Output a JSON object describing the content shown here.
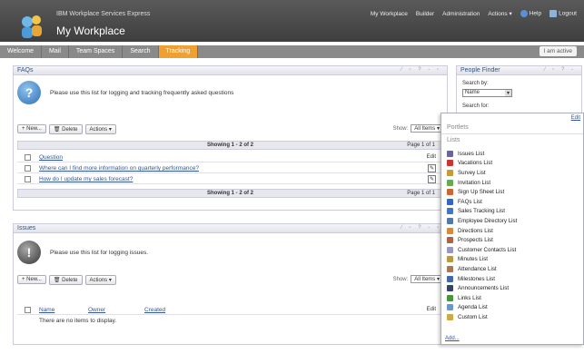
{
  "header": {
    "product": "IBM Workplace Services Express",
    "title": "My Workplace",
    "links": [
      "My Workplace",
      "Builder",
      "Administration",
      "Actions ▾",
      "Help",
      "Logout"
    ]
  },
  "nav": {
    "tabs": [
      "Welcome",
      "Mail",
      "Team Spaces",
      "Search",
      "Tracking"
    ],
    "status": "I am active"
  },
  "faqs": {
    "title": "FAQs",
    "intro": "Please use this list for logging and tracking  frequently asked questions",
    "new_label": "New...",
    "delete_label": "Delete",
    "actions_label": "Actions ▾",
    "show_label": "Show:",
    "show_value": "All Items",
    "showing": "Showing 1 - 2 of 2",
    "page": "Page 1 of 1",
    "col_question": "Question",
    "col_edit": "Edit",
    "rows": [
      "Where can I find more information on quarterly performance?",
      "How do I update my sales forecast?"
    ]
  },
  "issues": {
    "title": "Issues",
    "intro": "Please use this list for logging issues.",
    "new_label": "New...",
    "delete_label": "Delete",
    "actions_label": "Actions ▾",
    "show_label": "Show:",
    "show_value": "All Items",
    "col_name": "Name",
    "col_owner": "Owner",
    "col_created": "Created",
    "col_edit": "Edit",
    "empty": "There are no items to display."
  },
  "people_finder": {
    "title": "People Finder",
    "search_by": "Search by:",
    "search_by_value": "Name",
    "search_for": "Search for:"
  },
  "menu": {
    "edit": "Edit",
    "portlets": "Portlets",
    "lists": "Lists",
    "items": [
      "Issues List",
      "Vacations List",
      "Survey List",
      "Invitation List",
      "Sign Up Sheet List",
      "FAQs List",
      "Sales Tracking List",
      "Employee Directory List",
      "Directions List",
      "Prospects List",
      "Customer Contacts List",
      "Minutes List",
      "Attendance List",
      "Milestones List",
      "Announcements List",
      "Links List",
      "Agenda List",
      "Custom List"
    ],
    "item_colors": [
      "#666699",
      "#cc3333",
      "#cc9933",
      "#66aa55",
      "#cc6633",
      "#3366cc",
      "#4477bb",
      "#5577aa",
      "#dd8833",
      "#aa6644",
      "#9999bb",
      "#bb9944",
      "#aa7755",
      "#4466aa",
      "#334466",
      "#449933",
      "#6699cc",
      "#ccaa44"
    ],
    "add": "Add..."
  }
}
